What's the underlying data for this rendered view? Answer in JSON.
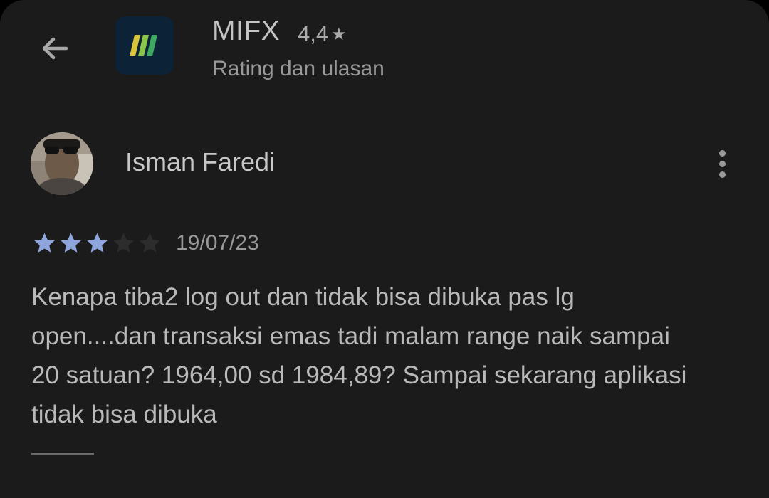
{
  "header": {
    "back_icon": "arrow-left-icon",
    "app_icon": "mifx-logo-icon",
    "app_name": "MIFX",
    "app_rating": "4,4",
    "rating_star_icon": "star-icon",
    "subtitle": "Rating dan ulasan"
  },
  "review": {
    "avatar": "reviewer-avatar",
    "reviewer_name": "Isman Faredi",
    "more_icon": "more-vert-icon",
    "stars": 3,
    "max_stars": 5,
    "date": "19/07/23",
    "text": "Kenapa tiba2 log out dan tidak bisa dibuka pas lg open....dan transaksi emas tadi malam range naik sampai 20 satuan? 1964,00 sd 1984,89? Sampai sekarang aplikasi tidak bisa dibuka"
  },
  "colors": {
    "background": "#1b1b1b",
    "star_filled": "#8fa6dd",
    "star_empty": "#2c2c2c"
  }
}
